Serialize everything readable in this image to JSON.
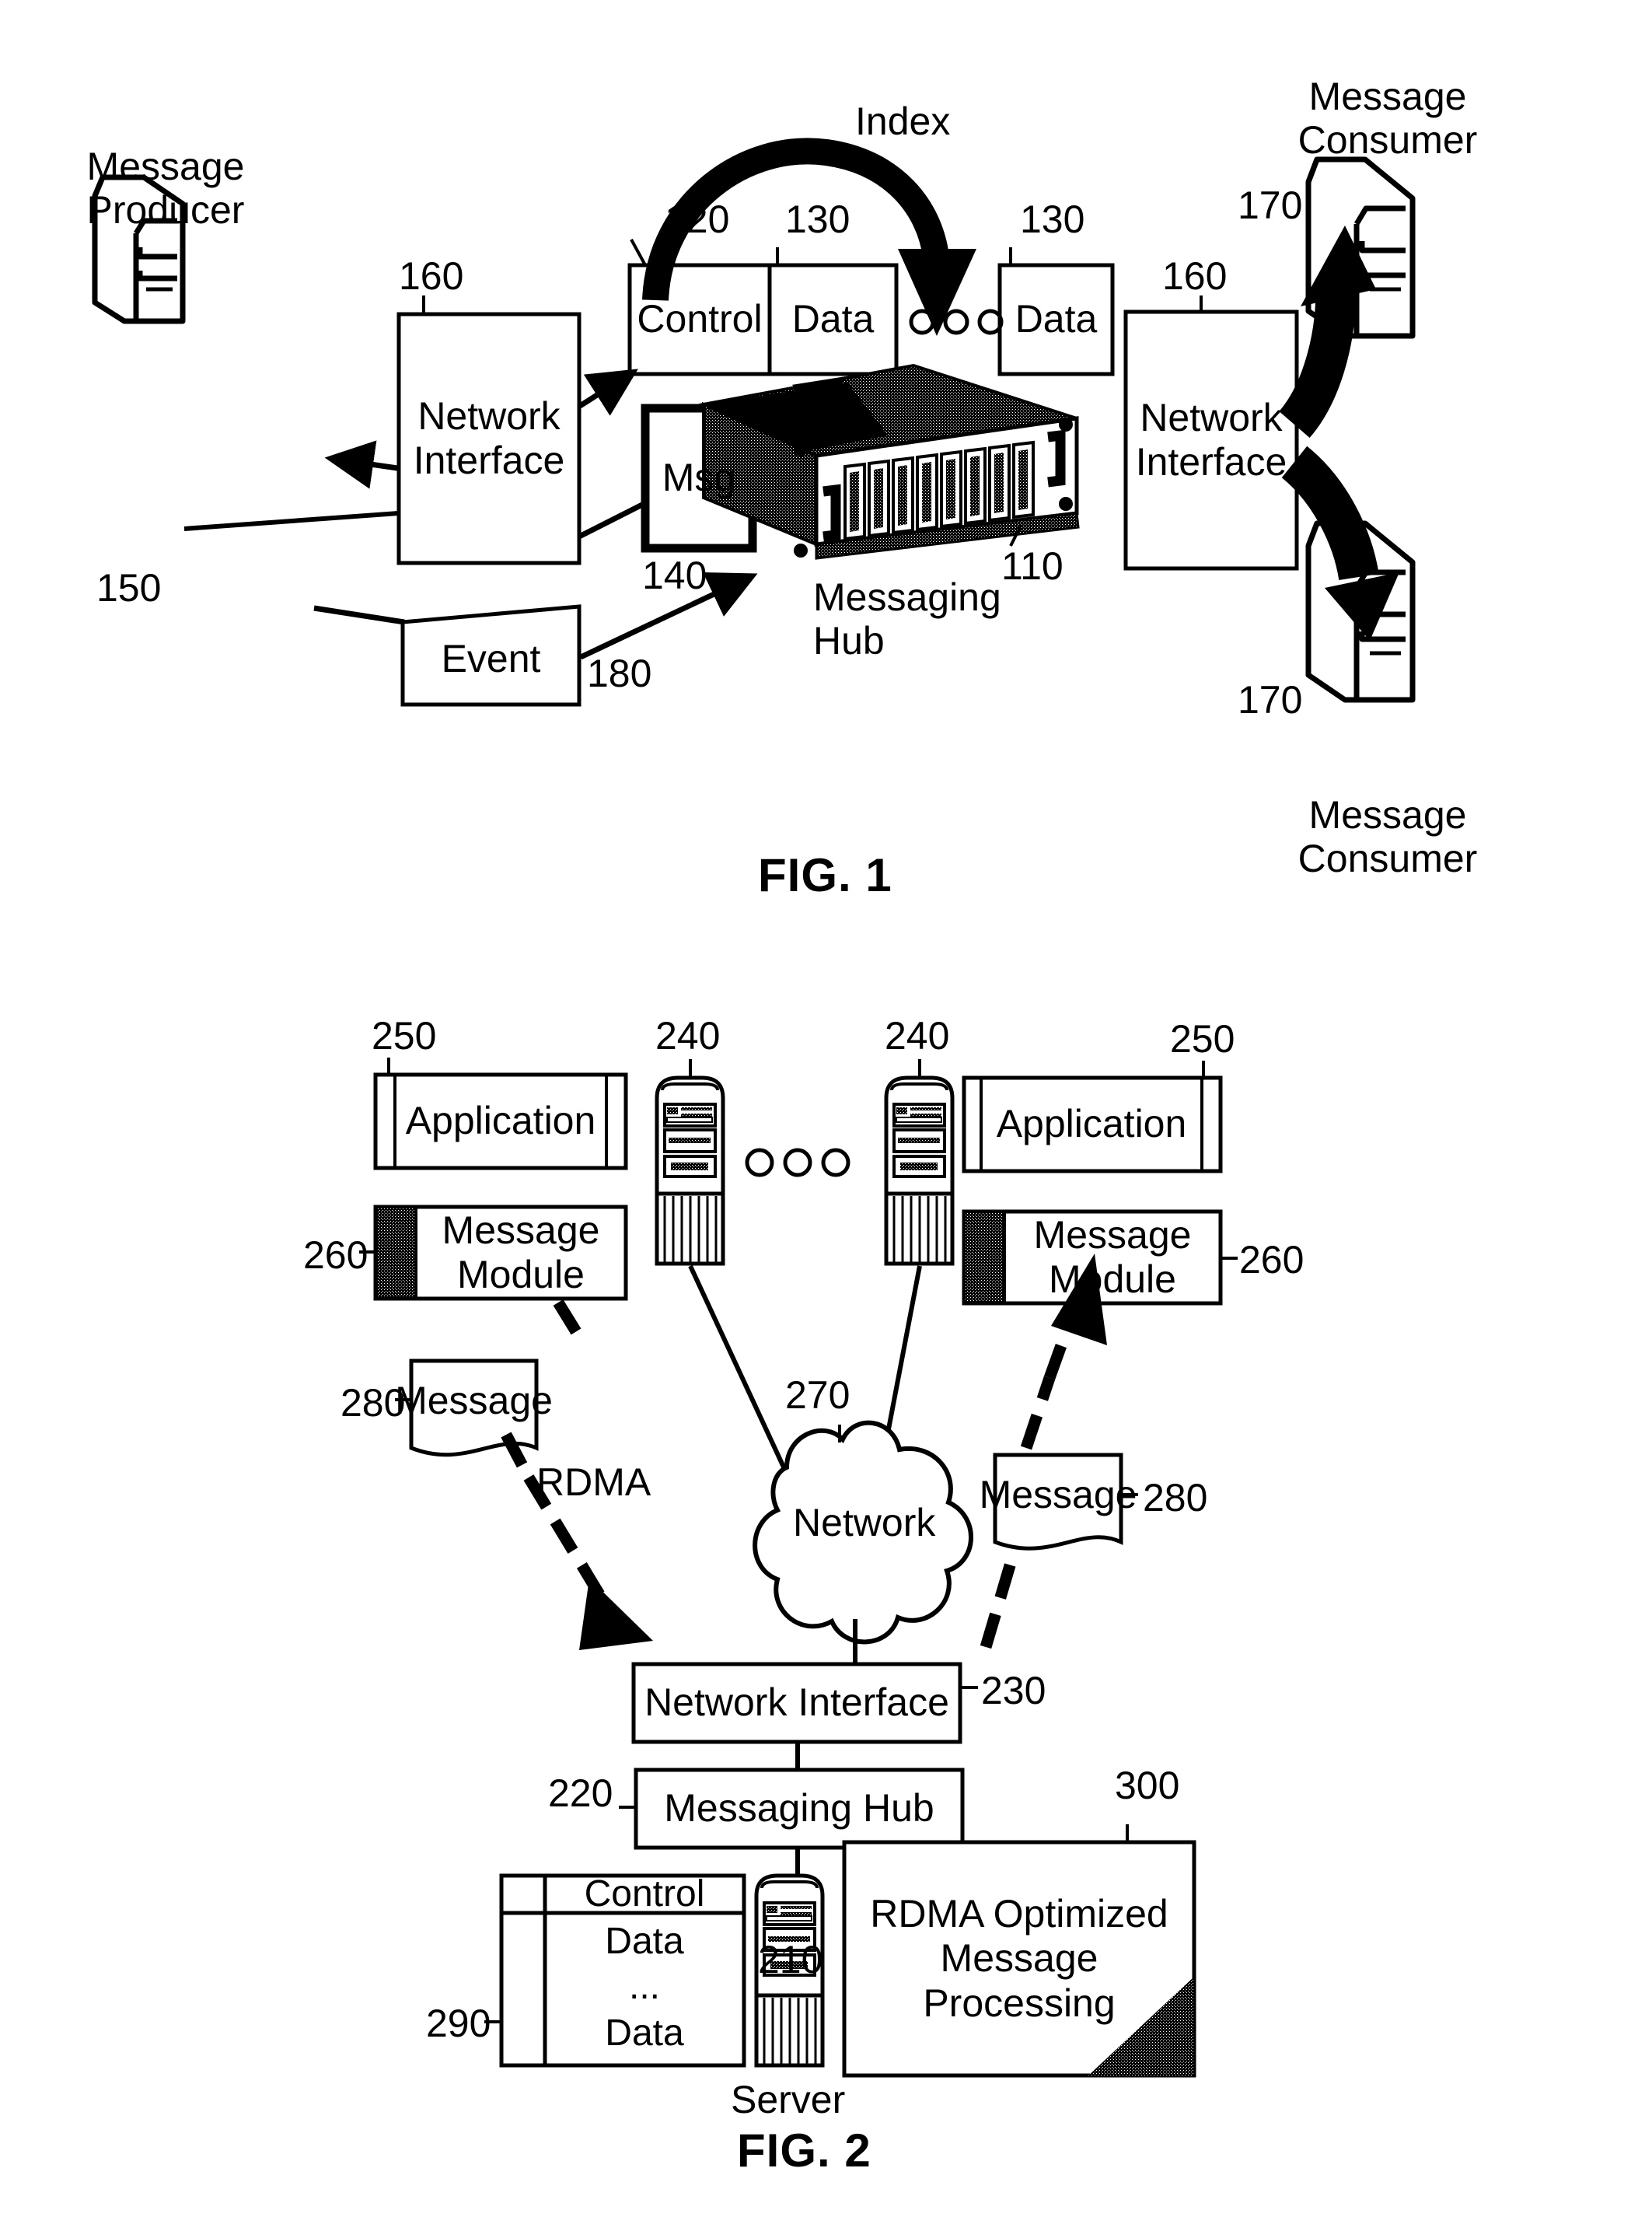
{
  "figures": [
    {
      "id": "fig1",
      "caption": "FIG. 1",
      "labels": {
        "message_producer": "Message\nProducer",
        "network_interface_left": "Network\nInterface",
        "network_interface_right": "Network\nInterface",
        "index": "Index",
        "control": "Control",
        "data_1": "Data",
        "data_2": "Data",
        "msg": "Msg",
        "event": "Event",
        "messaging_hub": "Messaging\nHub",
        "message_consumer_top": "Message\nConsumer",
        "message_consumer_bottom": "Message\nConsumer",
        "ellipsis": "ooo"
      },
      "refnums": {
        "hub": "110",
        "control": "120",
        "data_1": "130",
        "data_2": "130",
        "msg": "140",
        "producer": "150",
        "nic_left": "160",
        "nic_right": "160",
        "consumer_top": "170",
        "consumer_bottom": "170",
        "event": "180"
      }
    },
    {
      "id": "fig2",
      "caption": "FIG. 2",
      "labels": {
        "application_left": "Application",
        "application_right": "Application",
        "message_module_left": "Message\nModule",
        "message_module_right": "Message\nModule",
        "message_left": "Message",
        "message_right": "Message",
        "rdma": "RDMA",
        "network": "Network",
        "network_interface": "Network Interface",
        "messaging_hub": "Messaging Hub",
        "server": "Server",
        "rdma_box": "RDMA Optimized\nMessage\nProcessing",
        "queue_control": "Control",
        "queue_data_top": "Data",
        "queue_ellipsis": "...",
        "queue_data_bottom": "Data",
        "ellipsis": "ooo"
      },
      "refnums": {
        "server_center": "210",
        "messaging_hub": "220",
        "network_interface": "230",
        "client_left": "240",
        "client_right": "240",
        "application_left": "250",
        "application_right": "250",
        "message_module_left": "260",
        "message_module_right": "260",
        "network_cloud": "270",
        "message_left": "280",
        "message_right": "280",
        "queue": "290",
        "rdma_box": "300"
      }
    }
  ],
  "style": {
    "ink": "#000000",
    "paper": "#ffffff"
  }
}
